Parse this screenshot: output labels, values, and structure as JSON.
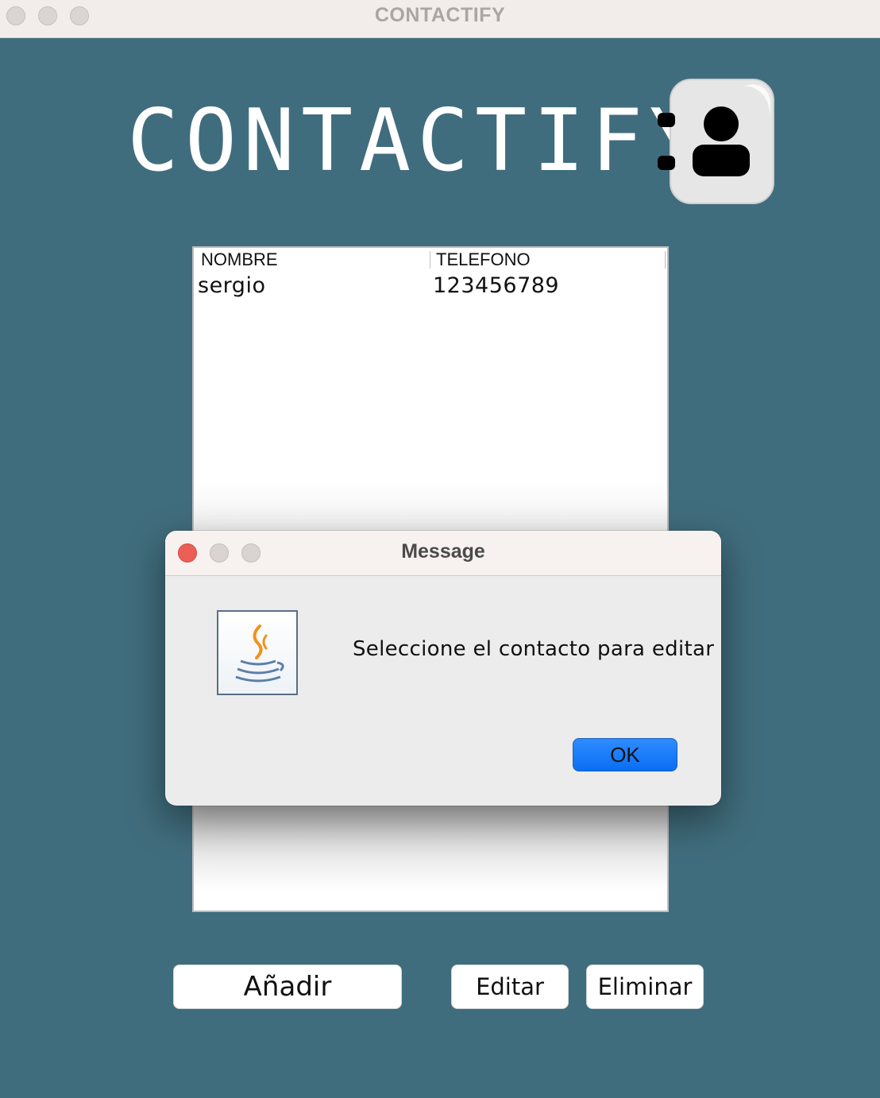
{
  "window": {
    "title": "CONTACTIFY"
  },
  "header": {
    "title": "CONTACTIFY",
    "logo_icon": "contact-book-icon"
  },
  "table": {
    "columns": [
      "NOMBRE",
      "TELEFONO"
    ],
    "rows": [
      {
        "nombre": "sergio",
        "telefono": "123456789"
      }
    ]
  },
  "actions": {
    "add_label": "Añadir",
    "edit_label": "Editar",
    "delete_label": "Eliminar"
  },
  "dialog": {
    "title": "Message",
    "message": "Seleccione el contacto para editar",
    "ok_label": "OK",
    "icon": "java-coffee-icon"
  },
  "colors": {
    "background": "#406d7d",
    "dialog_ok": "#0a6ef5",
    "close_red": "#ec5f56"
  }
}
